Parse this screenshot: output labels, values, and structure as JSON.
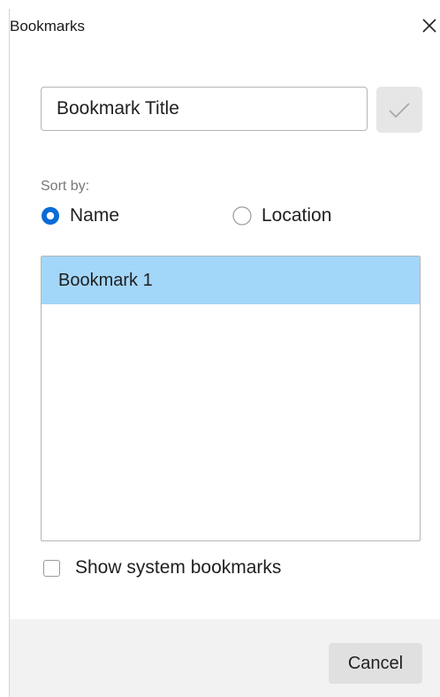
{
  "dialog": {
    "title": "Bookmarks",
    "close_icon": "close-icon"
  },
  "title_field": {
    "value": "Bookmark Title",
    "confirm_icon": "checkmark-icon"
  },
  "sort": {
    "label": "Sort by:",
    "options": [
      {
        "label": "Name",
        "selected": true
      },
      {
        "label": "Location",
        "selected": false
      }
    ]
  },
  "bookmarks": {
    "items": [
      {
        "label": "Bookmark 1",
        "selected": true
      }
    ]
  },
  "show_system": {
    "label": "Show system bookmarks",
    "checked": false
  },
  "footer": {
    "cancel_label": "Cancel"
  },
  "colors": {
    "accent": "#0a6cd6",
    "selection": "#a3d7f9",
    "footer_bg": "#f2f2f2",
    "button_bg": "#e0e0e0"
  }
}
